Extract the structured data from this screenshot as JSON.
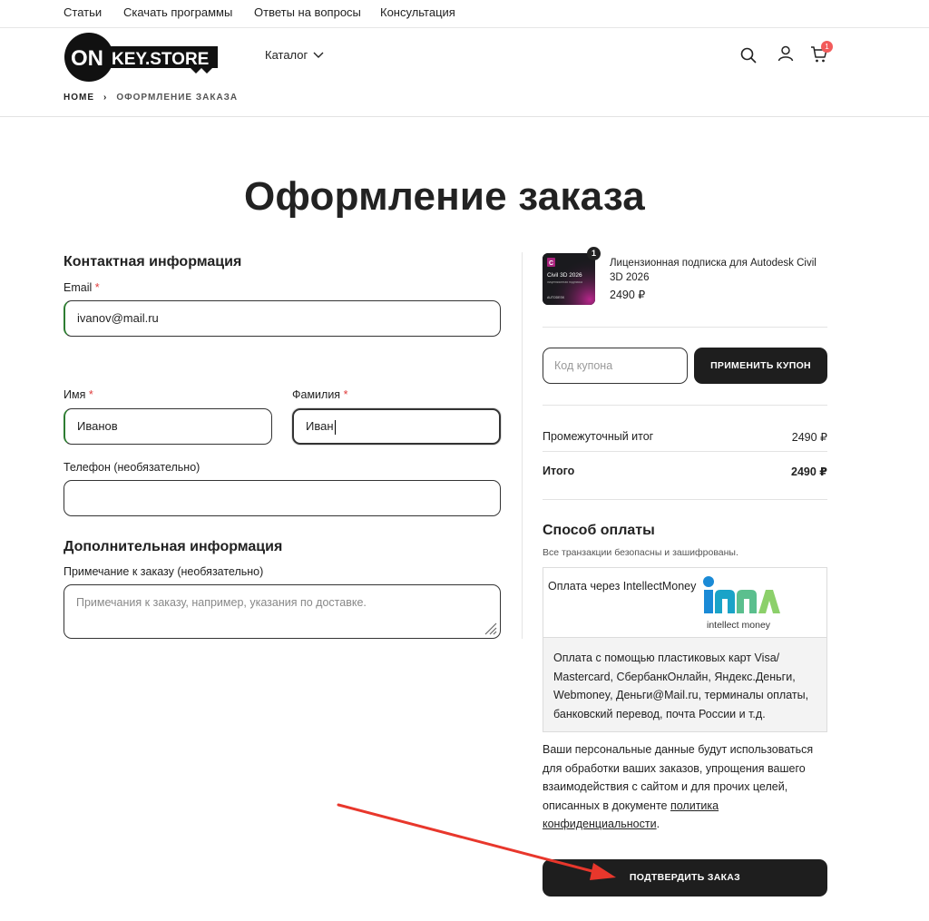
{
  "topnav": [
    "Статьи",
    "Скачать программы",
    "Ответы на вопросы",
    "Консультация"
  ],
  "logo": {
    "on": "ON",
    "key": "KEY.STORE"
  },
  "catalog_label": "Каталог",
  "cart_count": "1",
  "breadcrumb": {
    "home": "HOME",
    "separator": "›",
    "current": "ОФОРМЛЕНИЕ ЗАКАЗА"
  },
  "page_title": "Оформление заказа",
  "contact": {
    "title": "Контактная информация",
    "email_label": "Email",
    "required_mark": "*",
    "email_value": "ivanov@mail.ru",
    "first_name_label": "Имя",
    "first_name_value": "Иванов",
    "last_name_label": "Фамилия",
    "last_name_value": "Иван",
    "phone_label": "Телефон (необязательно)",
    "phone_value": ""
  },
  "additional": {
    "title": "Дополнительная информация",
    "note_label": "Примечание к заказу (необязательно)",
    "note_placeholder": "Примечания к заказу, например, указания по доставке."
  },
  "order": {
    "product_name": "Лицензионная подписка для Autodesk Civil 3D 2026",
    "product_price": "2490 ₽",
    "product_qty": "1",
    "thumb_title": "Civil 3D 2026",
    "thumb_sub": "лицензионная подписка",
    "thumb_brand": "AUTODESK",
    "coupon_placeholder": "Код купона",
    "coupon_button": "ПРИМЕНИТЬ КУПОН",
    "subtotal_label": "Промежуточный итог",
    "subtotal_value": "2490 ₽",
    "total_label": "Итого",
    "total_value": "2490 ₽"
  },
  "payment": {
    "title": "Способ оплаты",
    "subtitle": "Все транзакции безопасны и зашифрованы.",
    "method_name": "Оплата через IntellectMoney",
    "logo_text": "intellect money",
    "description": "Оплата с помощью пластиковых карт Visa/ Mastercard, СбербанкОнлайн, Яндекс.Деньги, Webmoney, Деньги@Mail.ru, терминалы оплаты, банковский перевод, почта России и т.д.",
    "privacy_text": "Ваши персональные данные будут использоваться для обработки ваших заказов, упрощения вашего взаимодействия с сайтом и для прочих целей, описанных в документе",
    "privacy_link": "политика конфиденциальности",
    "privacy_end": "."
  },
  "confirm_button": "ПОДТВЕРДИТЬ ЗАКАЗ",
  "colors": {
    "accent_dark": "#1e1e1e",
    "required": "#e03b3b",
    "badge": "#f25b5b",
    "annotation_arrow": "#e8372c",
    "focus_green": "#2e7d32"
  }
}
